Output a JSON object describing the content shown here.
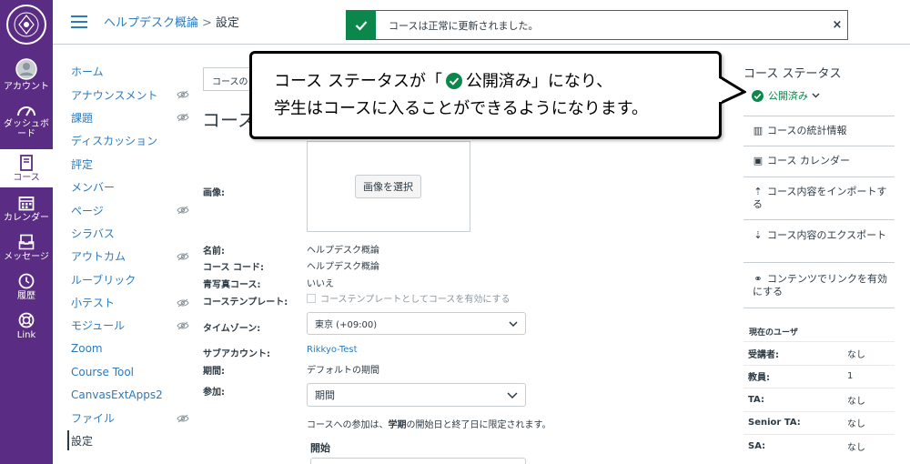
{
  "global_nav": {
    "account": "アカウント",
    "dashboard": "ダッシュボード",
    "courses": "コース",
    "calendar": "カレンダー",
    "inbox": "メッセージ",
    "history": "履歴",
    "link": "Link"
  },
  "header": {
    "course_name": "ヘルプデスク概論",
    "separator": ">",
    "page": "設定"
  },
  "toast": {
    "message": "コースは正常に更新されました。",
    "close": "×"
  },
  "course_nav": [
    {
      "label": "ホーム",
      "hidden": false
    },
    {
      "label": "アナウンスメント",
      "hidden": true
    },
    {
      "label": "課題",
      "hidden": true
    },
    {
      "label": "ディスカッション",
      "hidden": false
    },
    {
      "label": "評定",
      "hidden": false
    },
    {
      "label": "メンバー",
      "hidden": false
    },
    {
      "label": "ページ",
      "hidden": true
    },
    {
      "label": "シラバス",
      "hidden": false
    },
    {
      "label": "アウトカム",
      "hidden": true
    },
    {
      "label": "ルーブリック",
      "hidden": false
    },
    {
      "label": "小テスト",
      "hidden": true
    },
    {
      "label": "モジュール",
      "hidden": true
    },
    {
      "label": "Zoom",
      "hidden": false
    },
    {
      "label": "Course Tool",
      "hidden": false
    },
    {
      "label": "CanvasExtApps2",
      "hidden": false
    },
    {
      "label": "ファイル",
      "hidden": true
    },
    {
      "label": "設定",
      "hidden": false
    }
  ],
  "main": {
    "tab_stub": "コースの",
    "title_stub": "コース",
    "image_label": "画像:",
    "image_button": "画像を選択",
    "name_label": "名前:",
    "name_value": "ヘルプデスク概論",
    "code_label": "コース コード:",
    "code_value": "ヘルプデスク概論",
    "blueprint_label": "青写真コース:",
    "blueprint_value": "いいえ",
    "template_label": "コーステンプレート:",
    "template_value": "コーステンプレートとしてコースを有効にする",
    "timezone_label": "タイムゾーン:",
    "timezone_value": "東京 (+09:00)",
    "subaccount_label": "サブアカウント:",
    "subaccount_value": "Rikkyo-Test",
    "term_label": "期間:",
    "term_value": "デフォルトの期間",
    "participation_label": "参加:",
    "participation_value": "期間",
    "participation_note_pre": "コースへの参加は、",
    "participation_note_bold": "学期",
    "participation_note_post": "の開始日と終了日に限定されます。",
    "start_label": "開始"
  },
  "callout": {
    "line1_pre": "コース ステータスが「",
    "line1_status": "公開済み",
    "line1_post": "」になり、",
    "line2": "学生はコースに入ることができるようになります。"
  },
  "sidebar": {
    "title": "コース ステータス",
    "status": "公開済み",
    "buttons": [
      "コースの統計情報",
      "コース カレンダー",
      "コース内容をインポートする",
      "コース内容のエクスポート",
      "コンテンツでリンクを有効にする"
    ],
    "users_title": "現在のユーザ",
    "users": [
      {
        "role": "受講者:",
        "count": "なし"
      },
      {
        "role": "教員:",
        "count": "1"
      },
      {
        "role": "TA:",
        "count": "なし"
      },
      {
        "role": "Senior TA:",
        "count": "なし"
      },
      {
        "role": "SA:",
        "count": "なし"
      }
    ]
  },
  "colors": {
    "nav_purple": "#5b2c83",
    "link_blue": "#2b7abc",
    "success_green": "#0b874b",
    "text_dark": "#2d3b45",
    "border": "#c7cdd1"
  }
}
